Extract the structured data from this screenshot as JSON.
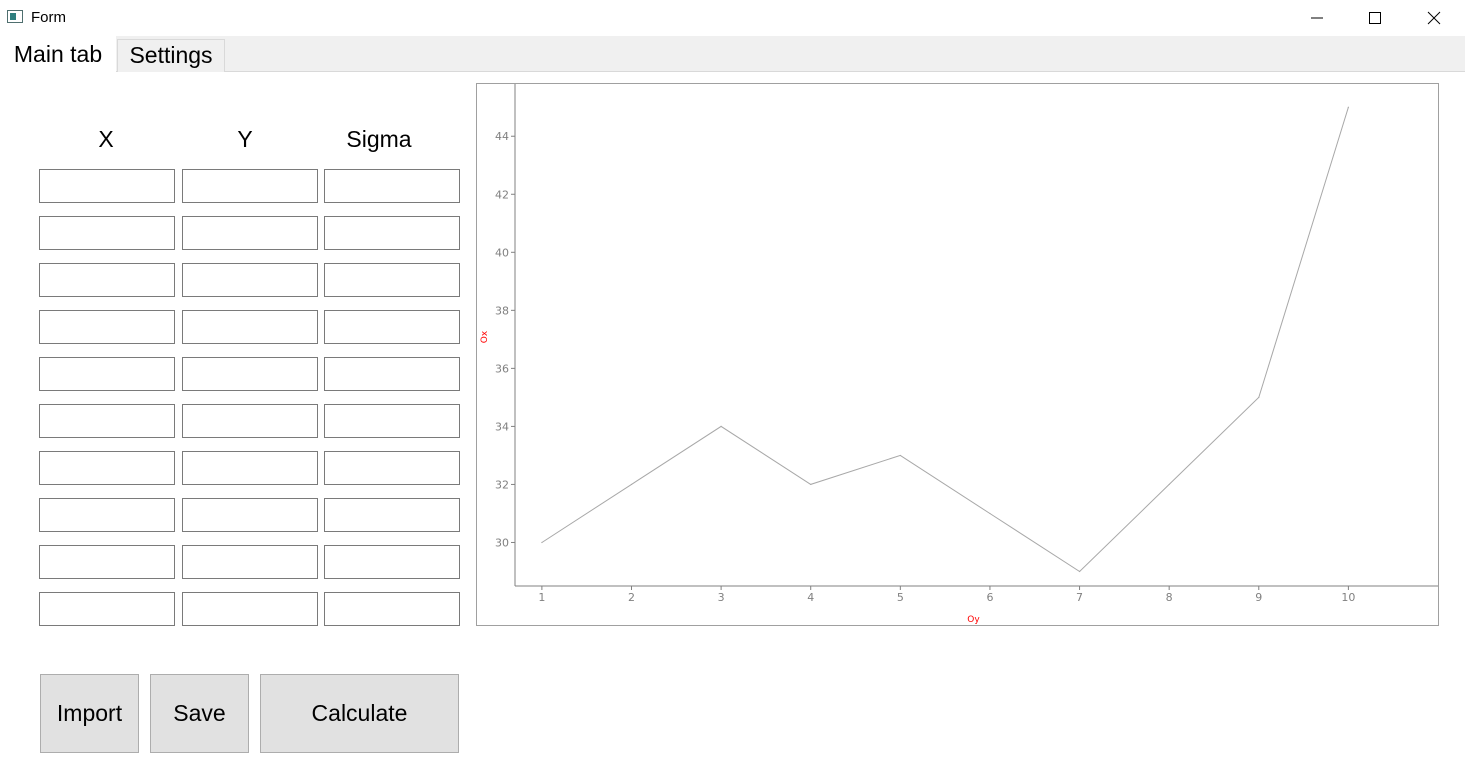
{
  "window": {
    "title": "Form"
  },
  "tabs": [
    {
      "label": "Main tab"
    },
    {
      "label": "Settings"
    }
  ],
  "table": {
    "headers": [
      "X",
      "Y",
      "Sigma"
    ],
    "rows": [
      {
        "x": "",
        "y": "",
        "sigma": ""
      },
      {
        "x": "",
        "y": "",
        "sigma": ""
      },
      {
        "x": "",
        "y": "",
        "sigma": ""
      },
      {
        "x": "",
        "y": "",
        "sigma": ""
      },
      {
        "x": "",
        "y": "",
        "sigma": ""
      },
      {
        "x": "",
        "y": "",
        "sigma": ""
      },
      {
        "x": "",
        "y": "",
        "sigma": ""
      },
      {
        "x": "",
        "y": "",
        "sigma": ""
      },
      {
        "x": "",
        "y": "",
        "sigma": ""
      },
      {
        "x": "",
        "y": "",
        "sigma": ""
      }
    ]
  },
  "buttons": {
    "import": "Import",
    "save": "Save",
    "calculate": "Calculate"
  },
  "chart_data": {
    "type": "line",
    "x": [
      1,
      2,
      3,
      4,
      5,
      6,
      7,
      8,
      9,
      10
    ],
    "series": [
      {
        "values": [
          30,
          32,
          34,
          32,
          33,
          31,
          29,
          32,
          35,
          45
        ]
      }
    ],
    "xlabel": "Oy",
    "ylabel": "Ox",
    "xticks": [
      1,
      2,
      3,
      4,
      5,
      6,
      7,
      8,
      9,
      10
    ],
    "yticks": [
      30,
      32,
      34,
      36,
      38,
      40,
      42,
      44
    ],
    "xlim": [
      0.7,
      11.0
    ],
    "ylim": [
      28.5,
      45.8
    ],
    "grid": false,
    "line_color": "#a8a8a8",
    "axis_label_color": "#ff0000",
    "tick_label_color": "#808080"
  }
}
